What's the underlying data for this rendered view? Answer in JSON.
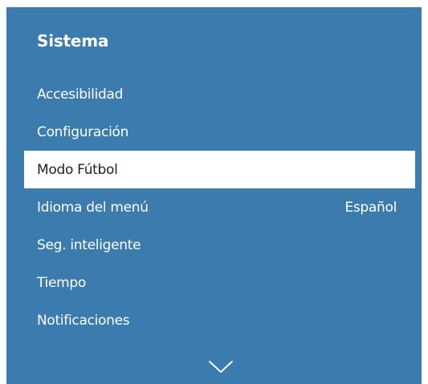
{
  "panel": {
    "title": "Sistema",
    "items": [
      {
        "label": "Accesibilidad",
        "value": ""
      },
      {
        "label": "Configuración",
        "value": ""
      },
      {
        "label": "Modo Fútbol",
        "value": ""
      },
      {
        "label": "Idioma del menú",
        "value": "Español"
      },
      {
        "label": "Seg. inteligente",
        "value": ""
      },
      {
        "label": "Tiempo",
        "value": ""
      },
      {
        "label": "Notificaciones",
        "value": ""
      }
    ],
    "scroll_icon": "chevron-down-icon"
  },
  "colors": {
    "panel_background": "#3b7bae",
    "selected_background": "#ffffff",
    "text": "#ffffff",
    "selected_text": "#222222"
  }
}
